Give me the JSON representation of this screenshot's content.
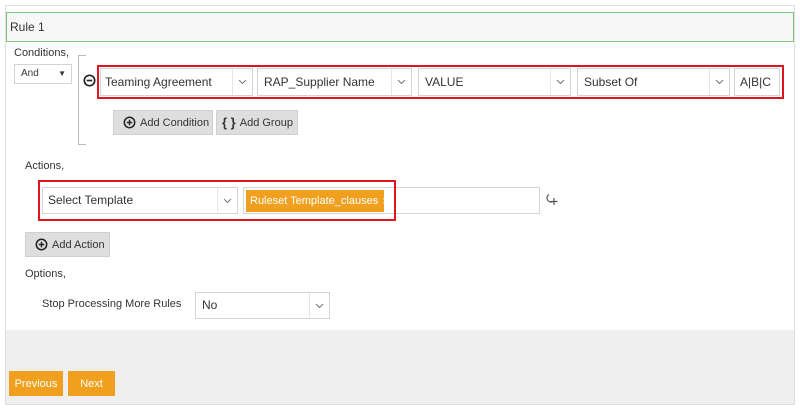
{
  "rule": {
    "title": "Rule 1"
  },
  "conditions": {
    "heading": "Conditions,",
    "logic_operator": "And",
    "row": {
      "field": "Teaming Agreement",
      "attribute": "RAP_Supplier Name",
      "value_type": "VALUE",
      "operator": "Subset Of",
      "value": "A|B|C"
    },
    "add_condition_label": "Add Condition",
    "add_group_label": "Add Group"
  },
  "actions": {
    "heading": "Actions,",
    "template_select_placeholder": "Select Template",
    "selected_template": "Ruleset Template_clauses",
    "chip_remove": "×",
    "add_action_label": "Add Action"
  },
  "options": {
    "heading": "Options,",
    "stop_processing_label": "Stop Processing More Rules",
    "stop_processing_value": "No"
  },
  "footer": {
    "previous_label": "Previous",
    "next_label": "Next"
  },
  "icons": {
    "remove_condition": "minus-circle-icon",
    "add_condition": "plus-circle-icon",
    "add_group": "braces-icon",
    "add_action": "plus-circle-icon",
    "template_action": "template-link-icon",
    "dropdown": "chevron-down-icon"
  },
  "colors": {
    "accent": "#f0a01e",
    "highlight": "#e0141e",
    "rule_border": "#7fc47f"
  }
}
